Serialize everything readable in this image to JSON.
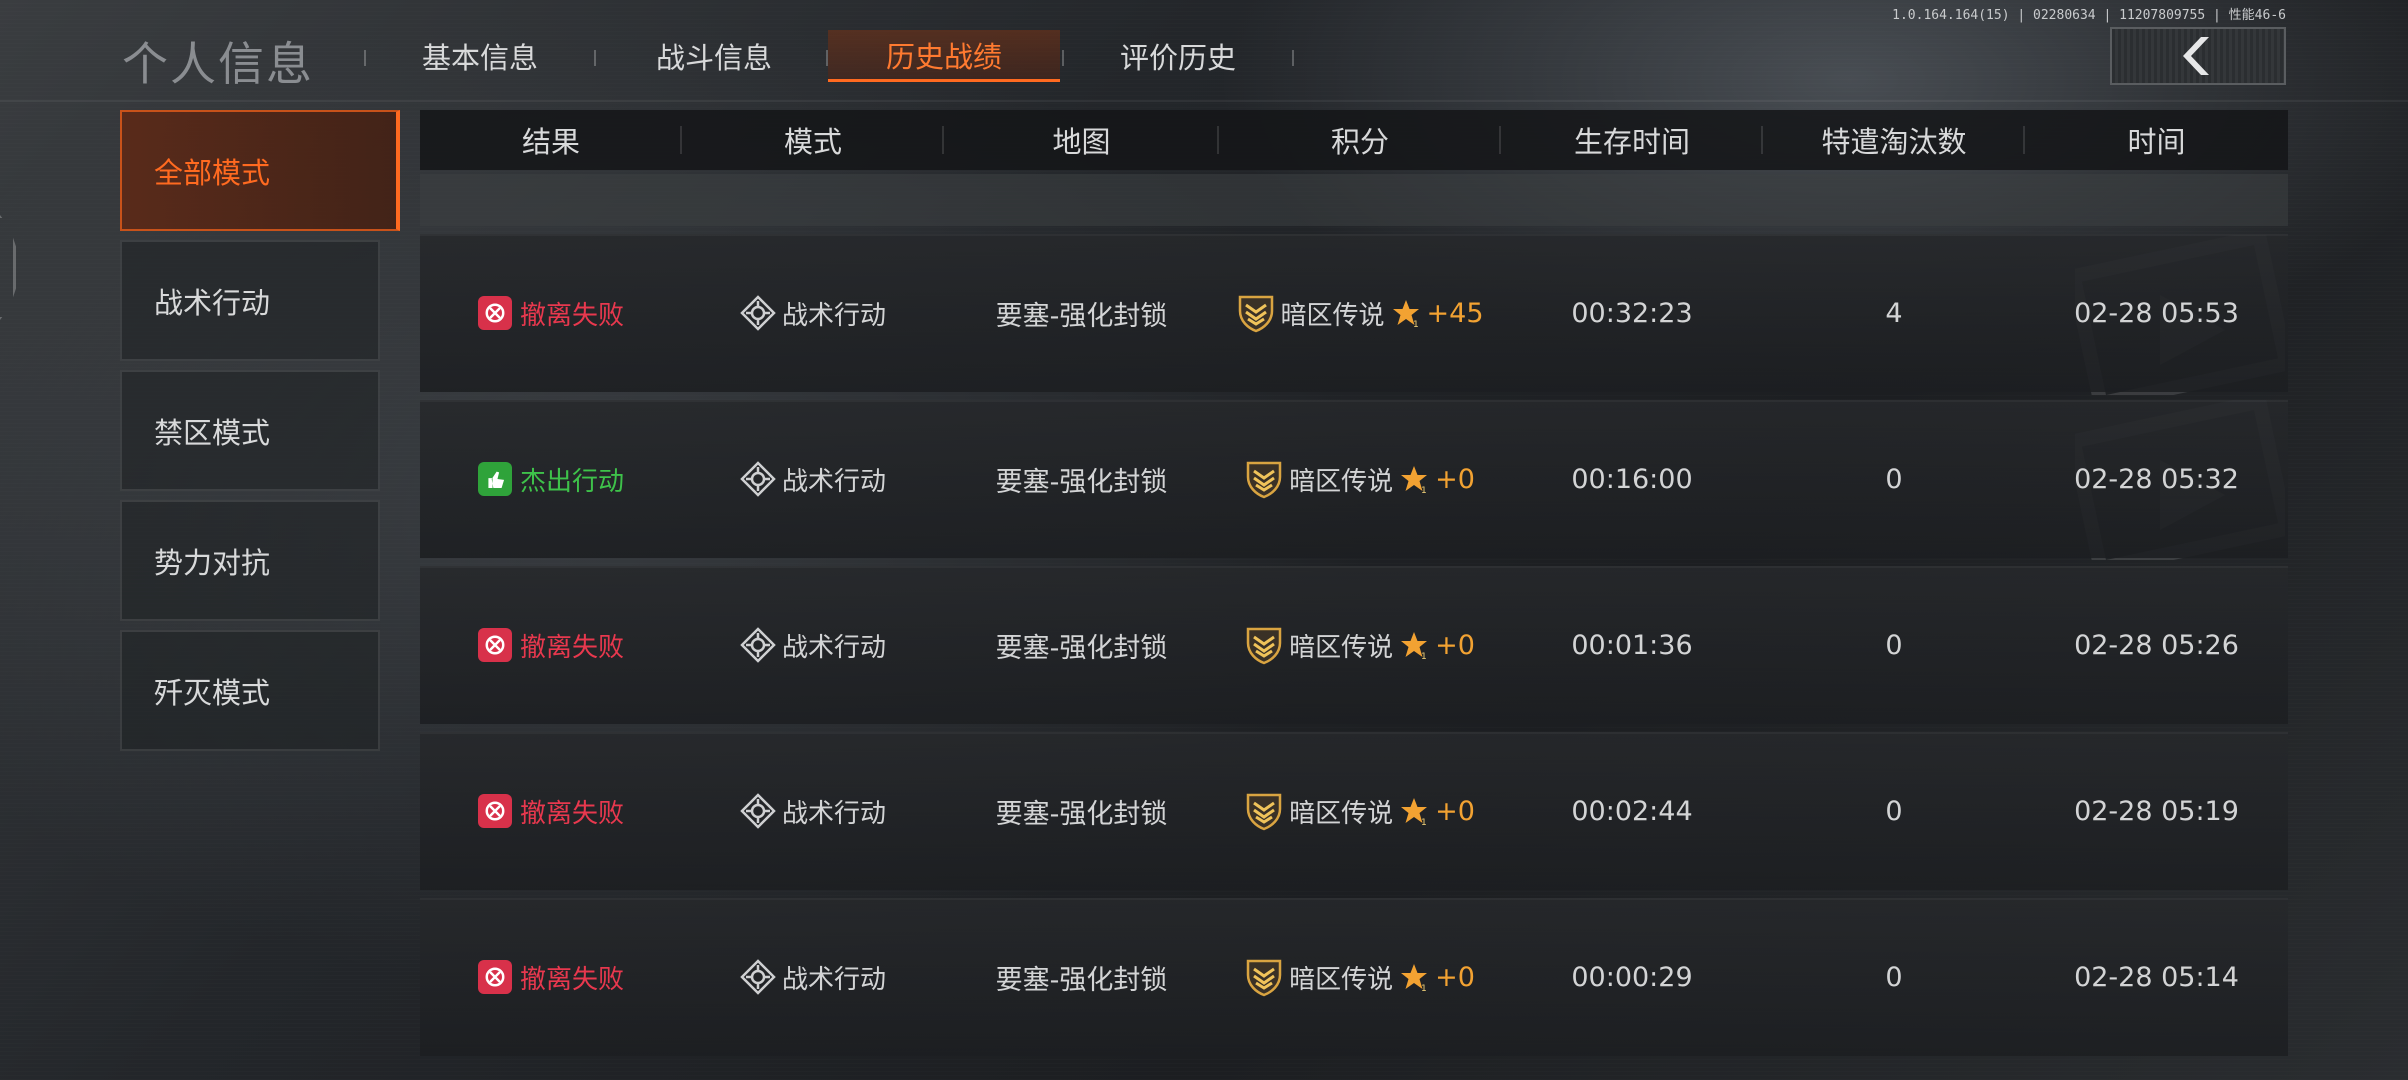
{
  "header": {
    "title": "个人信息",
    "tabs": [
      {
        "label": "基本信息",
        "active": false
      },
      {
        "label": "战斗信息",
        "active": false
      },
      {
        "label": "历史战绩",
        "active": true
      },
      {
        "label": "评价历史",
        "active": false
      }
    ],
    "version": "1.0.164.164(15) | 02280634 | 11207809755 | 性能46-6",
    "back_icon": "chevron-left-icon"
  },
  "sidebar": {
    "items": [
      {
        "label": "全部模式",
        "active": true
      },
      {
        "label": "战术行动",
        "active": false
      },
      {
        "label": "禁区模式",
        "active": false
      },
      {
        "label": "势力对抗",
        "active": false
      },
      {
        "label": "歼灭模式",
        "active": false
      }
    ]
  },
  "table": {
    "columns": [
      "结果",
      "模式",
      "地图",
      "积分",
      "生存时间",
      "特遣淘汰数",
      "时间"
    ],
    "rows": [
      {
        "result": "撤离失败",
        "result_type": "fail",
        "mode": "战术行动",
        "map": "要塞-强化封锁",
        "rank": "暗区传说",
        "score_delta": "+45",
        "survival": "00:32:23",
        "eliminations": "4",
        "time": "02-28 05:53"
      },
      {
        "result": "杰出行动",
        "result_type": "win",
        "mode": "战术行动",
        "map": "要塞-强化封锁",
        "rank": "暗区传说",
        "score_delta": "+0",
        "survival": "00:16:00",
        "eliminations": "0",
        "time": "02-28 05:32"
      },
      {
        "result": "撤离失败",
        "result_type": "fail",
        "mode": "战术行动",
        "map": "要塞-强化封锁",
        "rank": "暗区传说",
        "score_delta": "+0",
        "survival": "00:01:36",
        "eliminations": "0",
        "time": "02-28 05:26"
      },
      {
        "result": "撤离失败",
        "result_type": "fail",
        "mode": "战术行动",
        "map": "要塞-强化封锁",
        "rank": "暗区传说",
        "score_delta": "+0",
        "survival": "00:02:44",
        "eliminations": "0",
        "time": "02-28 05:19"
      },
      {
        "result": "撤离失败",
        "result_type": "fail",
        "mode": "战术行动",
        "map": "要塞-强化封锁",
        "rank": "暗区传说",
        "score_delta": "+0",
        "survival": "00:00:29",
        "eliminations": "0",
        "time": "02-28 05:14"
      }
    ]
  },
  "colors": {
    "accent": "#ff6a20",
    "fail": "#e8384e",
    "win": "#3ec24a",
    "score": "#f2a232"
  }
}
